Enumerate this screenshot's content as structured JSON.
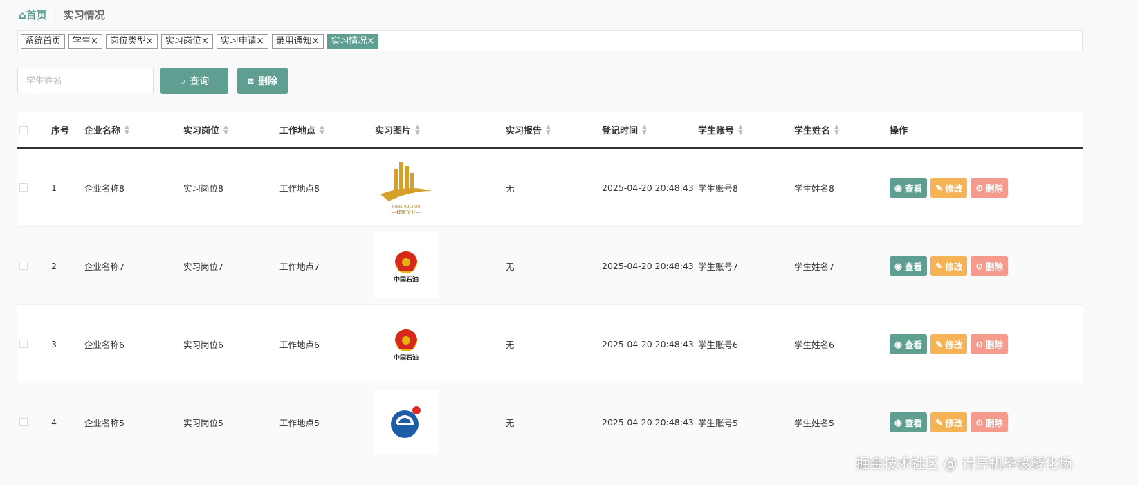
{
  "breadcrumb": {
    "home": "首页",
    "current": "实习情况"
  },
  "tabs": [
    "系统首页",
    "学生×",
    "岗位类型×",
    "实习岗位×",
    "实习申请×",
    "录用通知×",
    "实习情况×"
  ],
  "toolbar": {
    "search_placeholder": "学生姓名",
    "query": "查询",
    "delete": "删除"
  },
  "columns": [
    "序号",
    "企业名称",
    "实习岗位",
    "工作地点",
    "实习图片",
    "实习报告",
    "登记时间",
    "学生账号",
    "学生姓名",
    "操作"
  ],
  "actions": {
    "view": "查看",
    "edit": "修改",
    "delete": "删除"
  },
  "rows": [
    {
      "no": "1",
      "company": "企业名称8",
      "position": "实习岗位8",
      "location": "工作地点8",
      "image": "construction-logo",
      "logo_text": "CONSTRUCTION —建筑企业—",
      "report": "无",
      "time": "2025-04-20 20:48:43",
      "account": "学生账号8",
      "name": "学生姓名8"
    },
    {
      "no": "2",
      "company": "企业名称7",
      "position": "实习岗位7",
      "location": "工作地点7",
      "image": "petrochina-logo",
      "logo_text": "中国石油",
      "report": "无",
      "time": "2025-04-20 20:48:43",
      "account": "学生账号7",
      "name": "学生姓名7"
    },
    {
      "no": "3",
      "company": "企业名称6",
      "position": "实习岗位6",
      "location": "工作地点6",
      "image": "petrochina-logo",
      "logo_text": "中国石油",
      "report": "无",
      "time": "2025-04-20 20:48:43",
      "account": "学生账号6",
      "name": "学生姓名6"
    },
    {
      "no": "4",
      "company": "企业名称5",
      "position": "实习岗位5",
      "location": "工作地点5",
      "image": "blue-e-logo",
      "report": "无",
      "time": "2025-04-20 20:48:43",
      "account": "学生账号5",
      "name": "学生姓名5"
    }
  ],
  "watermark": "掘金技术社区 @ 计算机毕设孵化场"
}
